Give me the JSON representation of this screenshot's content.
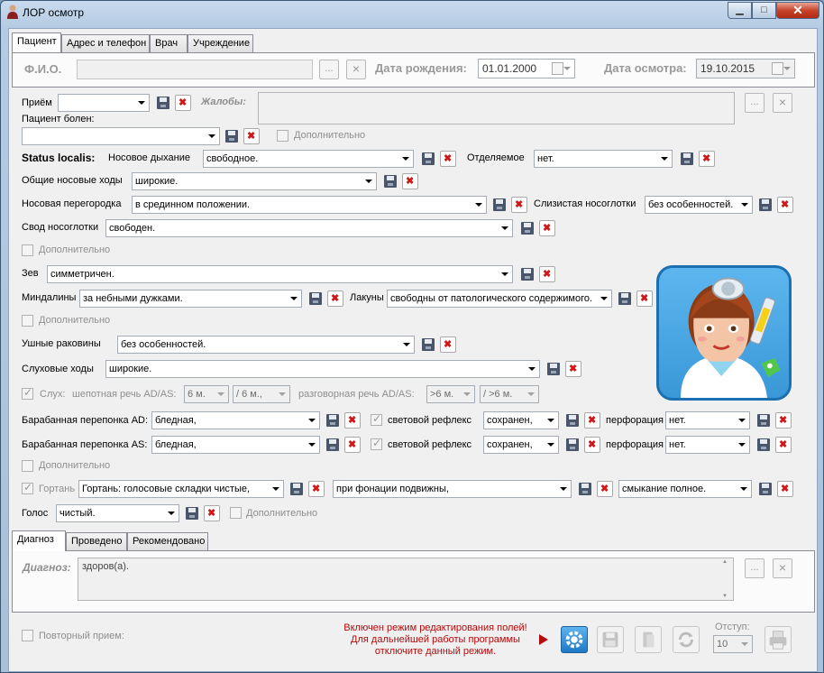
{
  "window": {
    "title": "ЛОР осмотр",
    "controls": {
      "minimize": "▁",
      "maximize": "□",
      "close": "✕"
    }
  },
  "tabs": [
    "Пациент",
    "Адрес и телефон",
    "Врач",
    "Учреждение"
  ],
  "patient": {
    "fio_label": "Ф.И.О.",
    "fio_value": "",
    "ellipsis": "...",
    "clear": "×",
    "birth_label": "Дата рождения:",
    "birth_value": "01.01.2000",
    "exam_label": "Дата осмотра:",
    "exam_value": "19.10.2015"
  },
  "reception": {
    "label": "Приём",
    "value": "",
    "complaints_label": "Жалобы:",
    "complaints_value": "",
    "ill_label": "Пациент болен:",
    "ill_value": "",
    "extra_label": "Дополнительно"
  },
  "status": {
    "label": "Status localis:",
    "nasal_breath_label": "Носовое дыхание",
    "nasal_breath_value": "свободное.",
    "discharge_label": "Отделяемое",
    "discharge_value": "нет.",
    "nasal_passages_label": "Общие носовые ходы",
    "nasal_passages_value": "широкие.",
    "septum_label": "Носовая перегородка",
    "septum_value": "в срединном положении.",
    "nasopharynx_mucosa_label": "Слизистая носоглотки",
    "nasopharynx_mucosa_value": "без особенностей.",
    "nasopharynx_vault_label": "Свод носоглотки",
    "nasopharynx_vault_value": "свободен.",
    "extra1_label": "Дополнительно",
    "pharynx_label": "Зев",
    "pharynx_value": "симметричен.",
    "tonsils_label": "Миндалины",
    "tonsils_value": "за небными дужками.",
    "lacunae_label": "Лакуны",
    "lacunae_value": "свободны от патологического содержимого.",
    "extra2_label": "Дополнительно",
    "auricles_label": "Ушные раковины",
    "auricles_value": "без особенностей.",
    "ear_canals_label": "Слуховые ходы",
    "ear_canals_value": "широкие.",
    "hearing_label": "Слух:",
    "whisper_label": "шепотная речь AD/AS:",
    "whisper_ad": "6 м.",
    "whisper_as": "/  6 м.,",
    "spoken_label": "разговорная речь AD/AS:",
    "spoken_ad": ">6 м.",
    "spoken_as": "/  >6 м.",
    "tm_ad_label": "Барабанная перепонка AD:",
    "tm_ad_value": "бледная,",
    "reflex_ad_label": "световой рефлекс",
    "reflex_ad_value": "сохранен,",
    "perf_ad_label": "перфорация",
    "perf_ad_value": "нет.",
    "tm_as_label": "Барабанная перепонка AS:",
    "tm_as_value": "бледная,",
    "reflex_as_label": "световой рефлекс",
    "reflex_as_value": "сохранен,",
    "perf_as_label": "перфорация",
    "perf_as_value": "нет.",
    "extra3_label": "Дополнительно",
    "larynx_label": "Гортань",
    "larynx_value1": "Гортань: голосовые складки чистые,",
    "larynx_value2": "при фонации подвижны,",
    "larynx_value3": "смыкание полное.",
    "voice_label": "Голос",
    "voice_value": "чистый.",
    "extra4_label": "Дополнительно"
  },
  "bottom_tabs": [
    "Диагноз",
    "Проведено",
    "Рекомендовано"
  ],
  "diagnosis": {
    "label": "Диагноз:",
    "value": "здоров(а)."
  },
  "footer": {
    "repeat_label": "Повторный прием:",
    "note_line1": "Включен режим редактирования полей!",
    "note_line2": "Для дальнейшей работы программы",
    "note_line3": "отключите данный режим.",
    "indent_label": "Отступ:",
    "indent_value": "10"
  },
  "colors": {
    "accent_red": "#b50a0a",
    "window_frame": "#b4cbe3",
    "settings_button": "#2b86d0"
  }
}
